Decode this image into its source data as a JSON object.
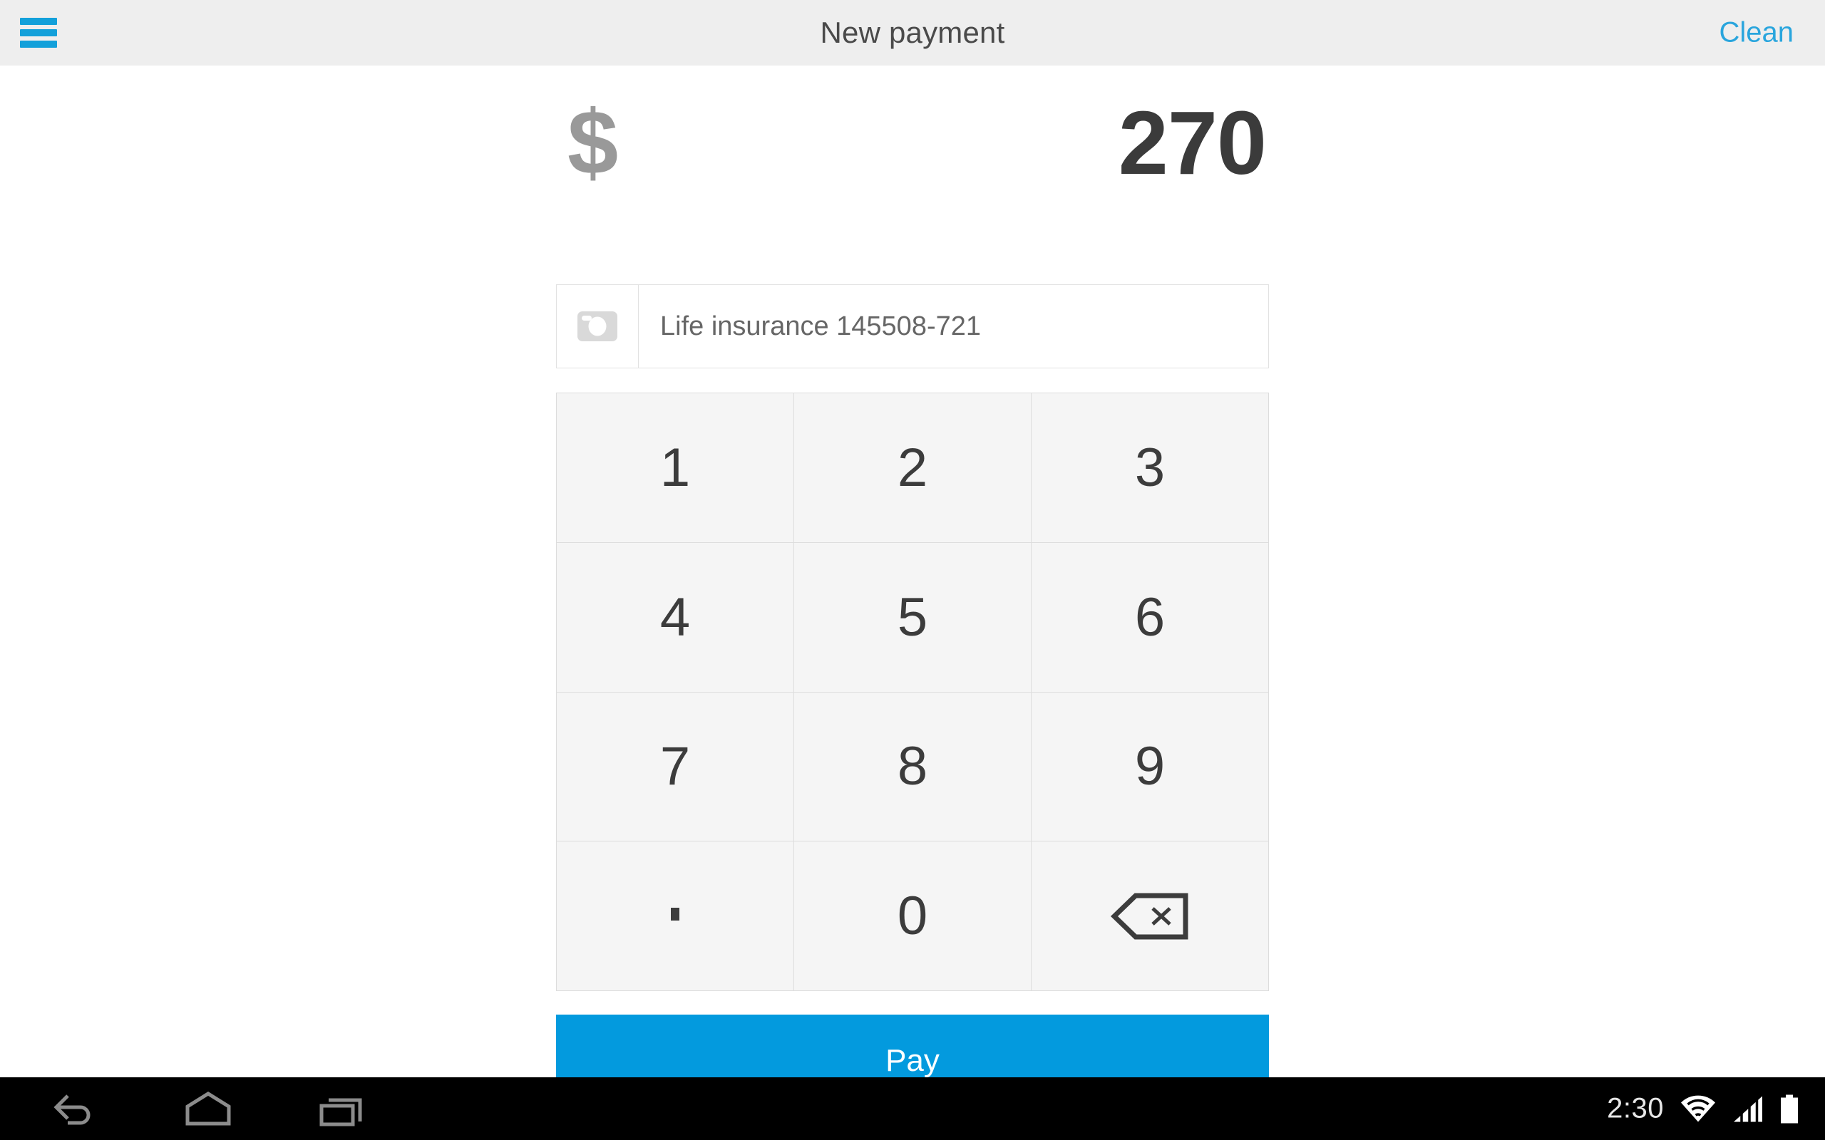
{
  "app": {
    "title": "New payment"
  },
  "actionbar": {
    "menu_icon": "hamburger-menu-icon",
    "title": "New payment",
    "action_label": "Clean",
    "accent_color": "#13a0da",
    "background_color": "#eeeeee"
  },
  "amount": {
    "currency_symbol": "$",
    "value": "270",
    "currency_color": "#999999",
    "value_color": "#3b3b3b"
  },
  "payment_item": {
    "icon": "banknote-icon",
    "label": "Life insurance 145508-721",
    "label_color": "#666666"
  },
  "keypad": {
    "keys": [
      {
        "label": "1",
        "name": "key-1",
        "type": "digit"
      },
      {
        "label": "2",
        "name": "key-2",
        "type": "digit"
      },
      {
        "label": "3",
        "name": "key-3",
        "type": "digit"
      },
      {
        "label": "4",
        "name": "key-4",
        "type": "digit"
      },
      {
        "label": "5",
        "name": "key-5",
        "type": "digit"
      },
      {
        "label": "6",
        "name": "key-6",
        "type": "digit"
      },
      {
        "label": "7",
        "name": "key-7",
        "type": "digit"
      },
      {
        "label": "8",
        "name": "key-8",
        "type": "digit"
      },
      {
        "label": "9",
        "name": "key-9",
        "type": "digit"
      },
      {
        "label": ".",
        "name": "key-decimal",
        "type": "dot"
      },
      {
        "label": "0",
        "name": "key-0",
        "type": "digit"
      },
      {
        "label": "",
        "name": "key-backspace",
        "type": "backspace"
      }
    ],
    "key_background": "#f5f5f5",
    "key_border": "#dddddd",
    "key_text_color": "#3c3c3c"
  },
  "pay": {
    "label": "Pay",
    "background_color": "#039ade",
    "text_color": "#ffffff"
  },
  "system_bar": {
    "back_icon": "back-arrow-icon",
    "home_icon": "home-icon",
    "recents_icon": "recent-apps-icon",
    "clock": "2:30",
    "wifi_icon": "wifi-icon",
    "signal_icon": "cellular-signal-icon",
    "battery_icon": "battery-full-icon",
    "background_color": "#000000"
  }
}
